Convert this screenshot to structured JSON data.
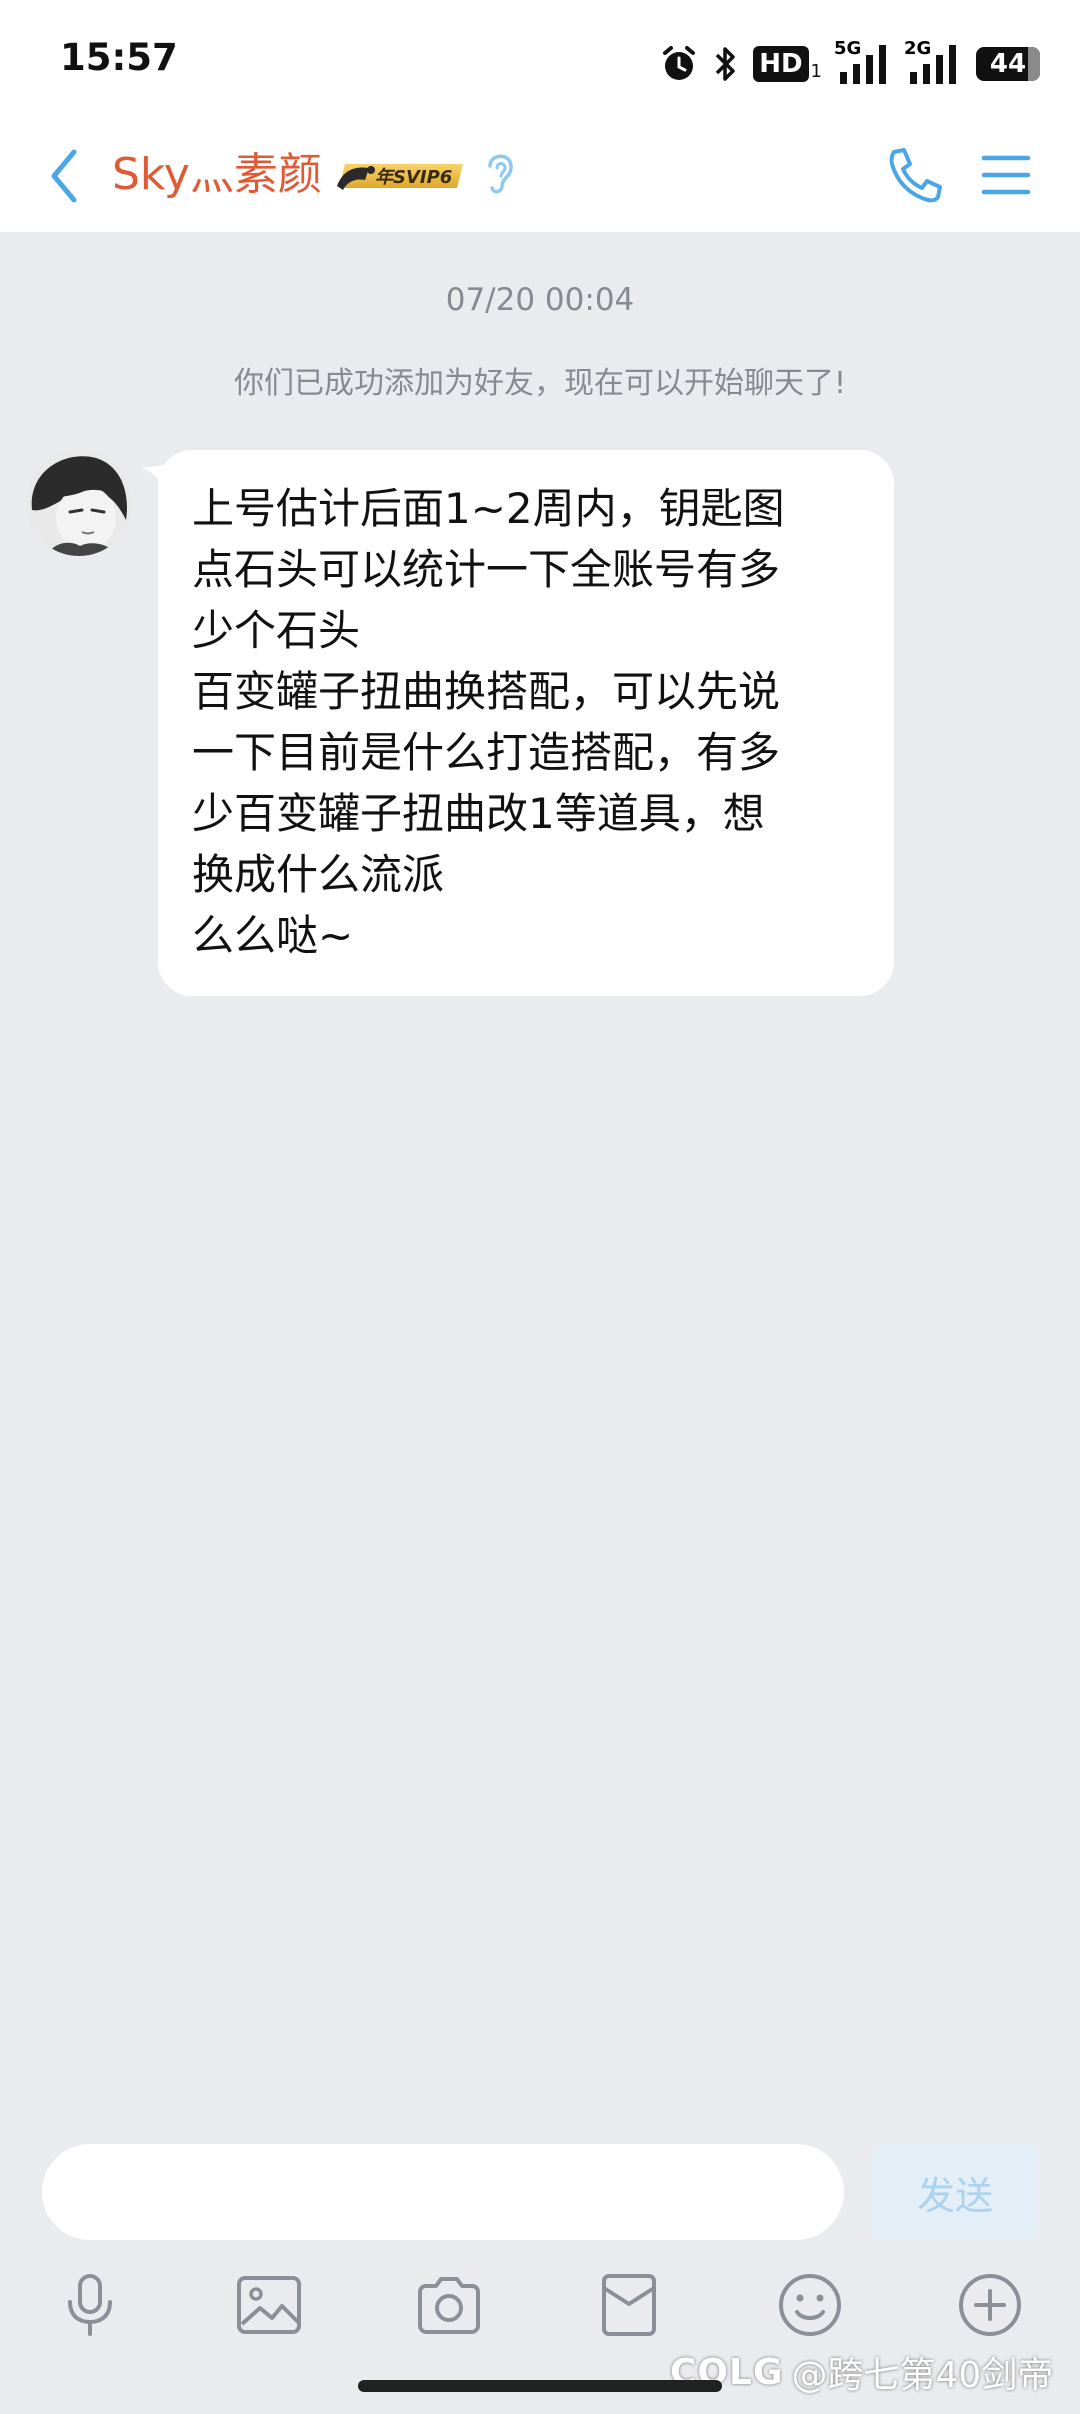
{
  "status_bar": {
    "time": "15:57",
    "hd_label": "HD",
    "hd_sub": "1",
    "signal_1_label": "5G",
    "signal_2_label": "2G",
    "battery_level": "44",
    "icons": [
      "alarm-icon",
      "bluetooth-icon",
      "hd-icon",
      "signal-5g-icon",
      "signal-2g-icon",
      "battery-icon"
    ]
  },
  "header": {
    "contact_name": "Sky灬素颜",
    "badge_text": "年SVIP6",
    "icons": [
      "back-arrow-icon",
      "ear-icon",
      "phone-icon",
      "menu-icon"
    ],
    "accent_color": "#4aa6e6",
    "name_color": "#e05a36"
  },
  "chat": {
    "timestamp": "07/20 00:04",
    "system_message": "你们已成功添加为好友，现在可以开始聊天了!",
    "messages": [
      {
        "lines": [
          "上号估计后面1~2周内，钥匙图",
          "点石头可以统计一下全账号有多",
          "少个石头",
          "百变罐子扭曲换搭配，可以先说",
          "一下目前是什么打造搭配，有多",
          "少百变罐子扭曲改1等道具，想",
          "换成什么流派",
          "么么哒~"
        ]
      }
    ]
  },
  "input_bar": {
    "value": "",
    "send_label": "发送"
  },
  "toolbar": {
    "icons": [
      "microphone-icon",
      "image-icon",
      "camera-icon",
      "red-packet-icon",
      "emoji-icon",
      "plus-icon"
    ]
  },
  "watermark": {
    "logo": "COLG",
    "text": "@跨七第40剑帝"
  }
}
